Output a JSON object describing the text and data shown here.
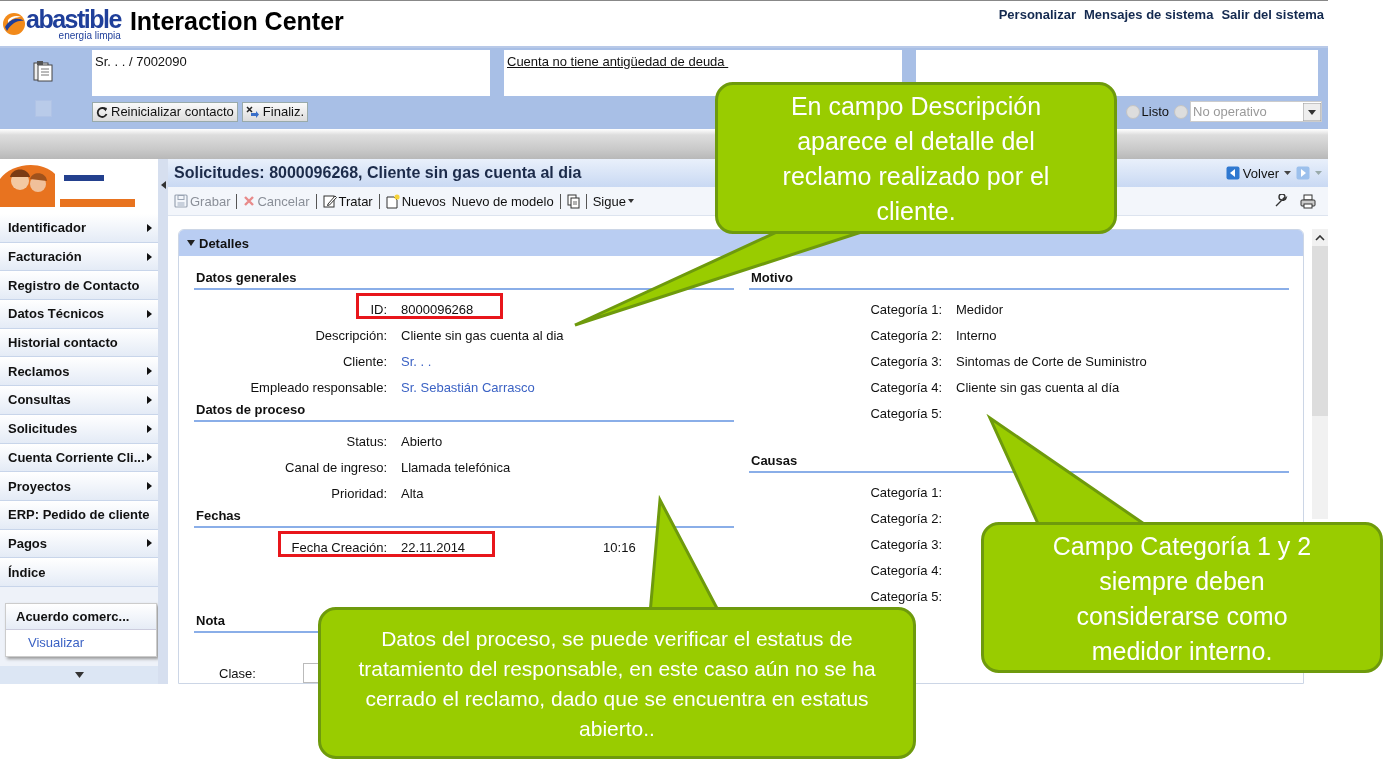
{
  "header": {
    "logo": {
      "brand": "abastible",
      "tagline": "energia limpia"
    },
    "title": "Interaction Center",
    "links": [
      "Personalizar",
      "Mensajes de sistema",
      "Salir del sistema"
    ]
  },
  "context": {
    "fields": [
      {
        "kind": "text",
        "text": "Sr. . . / 7002090"
      },
      {
        "kind": "link",
        "text": "Cuenta no tiene antigüedad de deuda "
      },
      {
        "kind": "empty"
      }
    ],
    "buttons": [
      {
        "label": "Reinicializar contacto",
        "kind": "reset"
      },
      {
        "label": "Finaliz.",
        "kind": "finish"
      }
    ],
    "availability": {
      "radios": [
        {
          "label": "Listo",
          "selected": false
        },
        {
          "selected": false
        }
      ],
      "dropdown": {
        "value": "No operativo",
        "disabled": true
      }
    }
  },
  "sidebar": {
    "items": [
      {
        "label": "Identificador",
        "submenu": true
      },
      {
        "label": "Facturación",
        "submenu": true
      },
      {
        "label": "Registro de Contacto",
        "submenu": false
      },
      {
        "label": "Datos Técnicos",
        "submenu": true
      },
      {
        "label": "Historial contacto",
        "submenu": false
      },
      {
        "label": "Reclamos",
        "submenu": true
      },
      {
        "label": "Consultas",
        "submenu": true
      },
      {
        "label": "Solicitudes",
        "submenu": true
      },
      {
        "label": "Cuenta Corriente Cli...",
        "submenu": true
      },
      {
        "label": "Proyectos",
        "submenu": true
      },
      {
        "label": "ERP: Pedido de cliente",
        "submenu": false
      },
      {
        "label": "Pagos",
        "submenu": true
      },
      {
        "label": "Índice",
        "submenu": false
      }
    ],
    "panel": {
      "title": "Acuerdo comerc...",
      "link": "Visualizar"
    }
  },
  "page": {
    "title": "Solicitudes: 8000096268, Cliente sin gas cuenta al dia",
    "back": "Volver",
    "toolbar": [
      {
        "kind": "save",
        "label": "Grabar",
        "disabled": true,
        "separated": false
      },
      {
        "kind": "cancel",
        "label": "Cancelar",
        "disabled": true,
        "separated": true
      },
      {
        "kind": "edit",
        "label": "Tratar",
        "disabled": false,
        "separated": true
      },
      {
        "kind": "new",
        "label": "Nuevos",
        "disabled": false,
        "separated": true
      },
      {
        "kind": "text",
        "label": "Nuevo de modelo",
        "disabled": false,
        "separated": false
      },
      {
        "kind": "copy",
        "separated": true
      },
      {
        "kind": "menu",
        "label": "Sigue",
        "separated": true
      }
    ]
  },
  "details": {
    "title": "Detalles",
    "expanded": true,
    "columns": [
      [
        {
          "title": "Datos generales",
          "fields": [
            {
              "label": "ID:",
              "value": "8000096268",
              "kind": "text",
              "highlighted": true
            },
            {
              "label": "Descripción:",
              "value": "Cliente sin gas cuenta al dia",
              "kind": "text",
              "highlighted": false
            },
            {
              "label": "Cliente:",
              "value": "Sr. . .",
              "kind": "link",
              "highlighted": false
            },
            {
              "label": "Empleado responsable:",
              "value": "Sr. Sebastián Carrasco",
              "kind": "link",
              "highlighted": false
            }
          ]
        },
        {
          "title": "Datos de proceso",
          "fields": [
            {
              "label": "Status:",
              "value": "Abierto",
              "kind": "text",
              "highlighted": false
            },
            {
              "label": "Canal de ingreso:",
              "value": "Llamada telefónica",
              "kind": "text",
              "highlighted": false
            },
            {
              "label": "Prioridad:",
              "value": "Alta",
              "kind": "text",
              "highlighted": false
            }
          ]
        },
        {
          "title": "Fechas",
          "fields": [
            {
              "label": "Fecha Creación:",
              "value": "22.11.2014",
              "time": "10:16",
              "kind": "text",
              "highlighted": true
            }
          ]
        },
        {
          "title": "Nota",
          "fields": [
            {
              "label": "Clase:",
              "kind": "input",
              "highlighted": false
            }
          ]
        }
      ],
      [
        {
          "title": "Motivo",
          "fields": [
            {
              "label": "Categoría 1:",
              "value": "Medidor",
              "kind": "text",
              "highlighted": false
            },
            {
              "label": "Categoría 2:",
              "value": "Interno",
              "kind": "text",
              "highlighted": false
            },
            {
              "label": "Categoría 3:",
              "value": "Sintomas de Corte de Suministro",
              "kind": "text",
              "highlighted": false
            },
            {
              "label": "Categoría 4:",
              "value": "Cliente sin gas cuenta al día",
              "kind": "text",
              "highlighted": false
            },
            {
              "label": "Categoría 5:",
              "kind": "text",
              "highlighted": false
            }
          ]
        },
        {
          "title": "Causas",
          "fields": [
            {
              "label": "Categoría 1:",
              "kind": "text",
              "highlighted": false
            },
            {
              "label": "Categoría 2:",
              "kind": "text",
              "highlighted": false
            },
            {
              "label": "Categoría 3:",
              "kind": "text",
              "highlighted": false
            },
            {
              "label": "Categoría 4:",
              "kind": "text",
              "highlighted": false
            },
            {
              "label": "Categoría 5:",
              "kind": "text",
              "highlighted": false
            }
          ]
        }
      ]
    ]
  },
  "callouts": [
    {
      "text": "En campo Descripción aparece el detalle del reclamo realizado por el cliente."
    },
    {
      "text": "Datos del proceso, se puede verificar el estatus de tratamiento del responsable, en este caso aún no se ha cerrado el reclamo, dado que se encuentra en estatus abierto.."
    },
    {
      "text": "Campo Categoría 1 y 2 siempre deben considerarse como medidor interno."
    }
  ]
}
